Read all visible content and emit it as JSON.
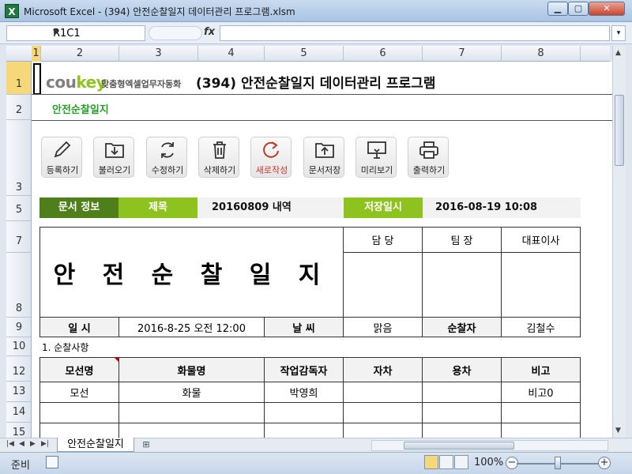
{
  "window": {
    "title": "Microsoft Excel - (394) 안전순찰일지 데이터관리 프로그램.xlsm",
    "app_icon": "X",
    "min_glyph": "▁",
    "max_glyph": "▢",
    "close_glyph": "✕"
  },
  "formula_bar": {
    "name_box": "R1C1",
    "fx": "fx",
    "value": ""
  },
  "columns": [
    "1",
    "2",
    "3",
    "4",
    "5",
    "6",
    "7",
    "8"
  ],
  "rows": [
    "1",
    "2",
    "3",
    "5",
    "7",
    "8",
    "9",
    "10",
    "12",
    "13",
    "14",
    "15"
  ],
  "header": {
    "logo_part1": "cou",
    "logo_part2": "key",
    "logo_sub": "맞춤형엑셀업무자동화",
    "title": "(394) 안전순찰일지 데이터관리 프로그램",
    "subtitle": "안전순찰일지"
  },
  "toolbar": [
    {
      "label": "등록하기",
      "icon": "pencil-icon"
    },
    {
      "label": "불러오기",
      "icon": "import-icon"
    },
    {
      "label": "수정하기",
      "icon": "refresh-icon"
    },
    {
      "label": "삭제하기",
      "icon": "trash-icon"
    },
    {
      "label": "새로작성",
      "icon": "new-icon"
    },
    {
      "label": "문서저장",
      "icon": "save-folder-icon"
    },
    {
      "label": "미리보기",
      "icon": "preview-icon"
    },
    {
      "label": "출력하기",
      "icon": "printer-icon"
    }
  ],
  "doc_info": {
    "label": "문서 정보",
    "title_label": "제목",
    "title_value": "20160809 내역",
    "saved_label": "저장일시",
    "saved_value": "2016-08-19 10:08"
  },
  "form": {
    "big_title": "안 전 순 찰 일 지",
    "sign": [
      "담 당",
      "팀 장",
      "대표이사"
    ],
    "date_label": "일 시",
    "date_value": "2016-8-25 오전 12:00",
    "weather_label": "날 씨",
    "weather_value": "맑음",
    "patrol_label": "순찰자",
    "patrol_value": "김철수",
    "section": "1. 순찰사항",
    "table_headers": [
      "모선명",
      "화물명",
      "작업감독자",
      "자차",
      "용차",
      "비고"
    ],
    "table_rows": [
      [
        "모선",
        "화물",
        "박영희",
        "",
        "",
        "비고0"
      ],
      [
        "",
        "",
        "",
        "",
        "",
        ""
      ],
      [
        "",
        "",
        "",
        "",
        "",
        ""
      ]
    ]
  },
  "sheet_tab": "안전순찰일지",
  "status": {
    "ready": "준비",
    "zoom": "100%"
  }
}
